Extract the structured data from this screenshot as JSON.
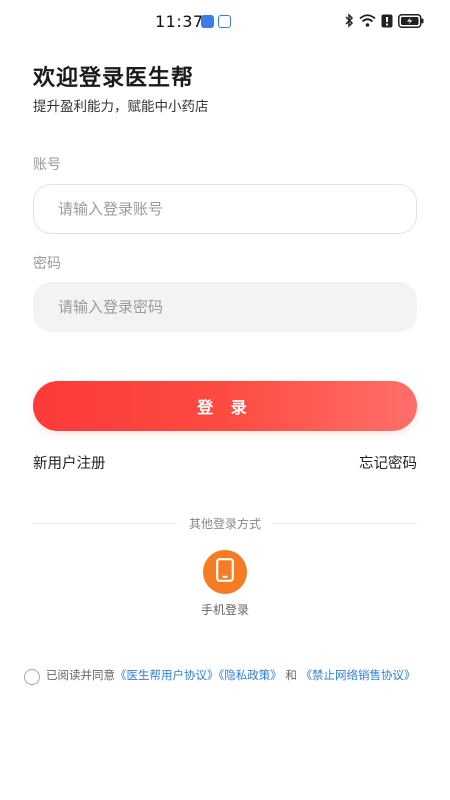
{
  "status_bar": {
    "time": "11:37",
    "icons": [
      "app-notification-icon",
      "app-notification-icon",
      "bluetooth-icon",
      "wifi-icon",
      "alert-icon",
      "battery-charging-icon"
    ]
  },
  "header": {
    "title": "欢迎登录医生帮",
    "subtitle": "提升盈利能力，赋能中小药店"
  },
  "form": {
    "account_label": "账号",
    "account_placeholder": "请输入登录账号",
    "account_value": "",
    "password_label": "密码",
    "password_placeholder": "请输入登录密码",
    "password_value": "",
    "login_button": "登 录"
  },
  "links": {
    "register": "新用户注册",
    "forgot": "忘记密码"
  },
  "other_login": {
    "divider_text": "其他登录方式",
    "phone_label": "手机登录"
  },
  "agreement": {
    "checked": false,
    "prefix": "已阅读并同意",
    "user_agreement": "《医生帮用户协议》",
    "privacy_policy": "《隐私政策》",
    "and": "和",
    "network_sales": "《禁止网络销售协议》"
  },
  "colors": {
    "accent": "#fc3a3a",
    "accent_light": "#fe6f6a",
    "phone_icon_bg": "#f57c22",
    "link": "#2f7fd9"
  }
}
